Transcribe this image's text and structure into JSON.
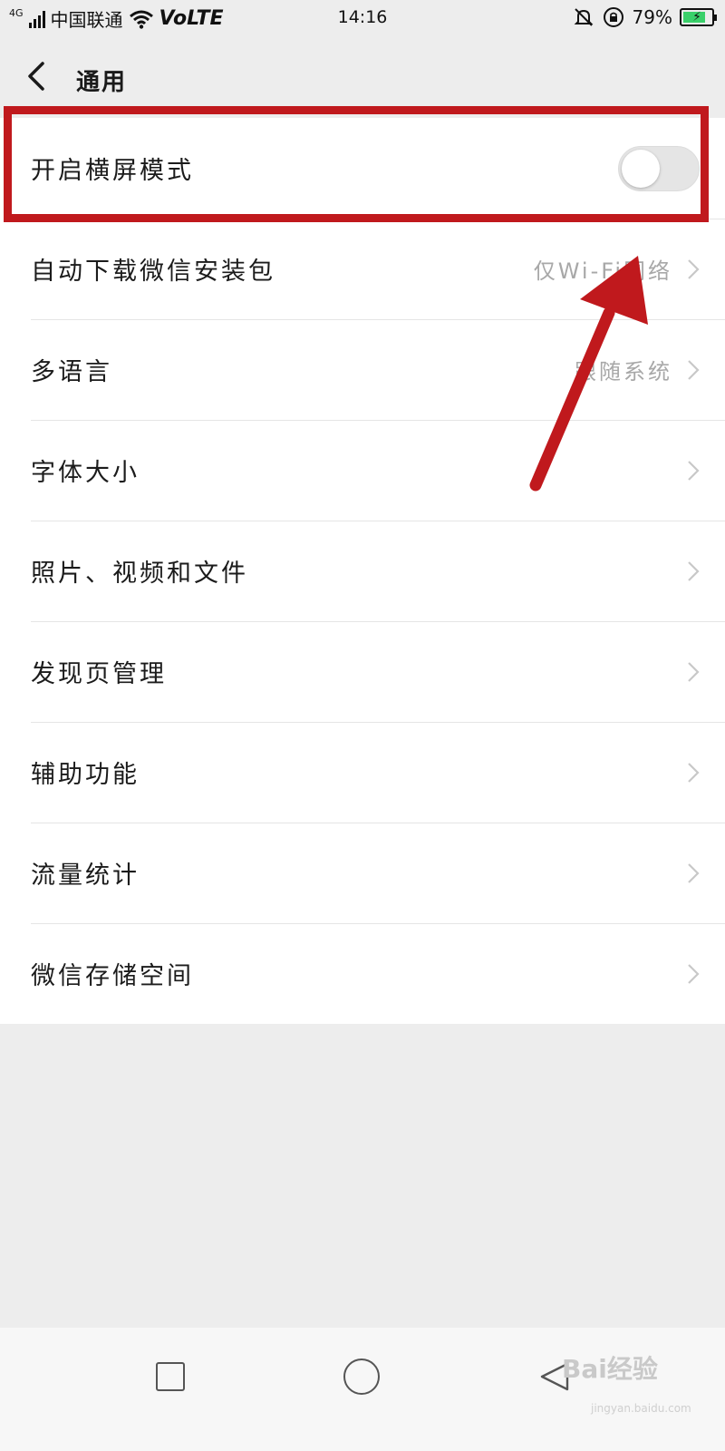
{
  "status_bar": {
    "network": "4G",
    "carrier": "中国联通",
    "volte": "VoLTE",
    "time": "14:16",
    "battery_percent": "79%",
    "battery_level": 0.79
  },
  "nav": {
    "title": "通用"
  },
  "settings": {
    "landscape": {
      "label": "开启横屏模式",
      "enabled": false
    },
    "items": [
      {
        "label": "自动下载微信安装包",
        "value": "仅Wi-Fi网络"
      },
      {
        "label": "多语言",
        "value": "跟随系统"
      },
      {
        "label": "字体大小",
        "value": ""
      },
      {
        "label": "照片、视频和文件",
        "value": ""
      },
      {
        "label": "发现页管理",
        "value": ""
      },
      {
        "label": "辅助功能",
        "value": ""
      },
      {
        "label": "流量统计",
        "value": ""
      },
      {
        "label": "微信存储空间",
        "value": ""
      }
    ]
  },
  "watermark": {
    "brand": "Bai经验",
    "url": "jingyan.baidu.com"
  },
  "colors": {
    "annotation": "#c0191d",
    "background": "#ededed",
    "row_background": "#ffffff",
    "value_text": "#a8a8a8"
  }
}
